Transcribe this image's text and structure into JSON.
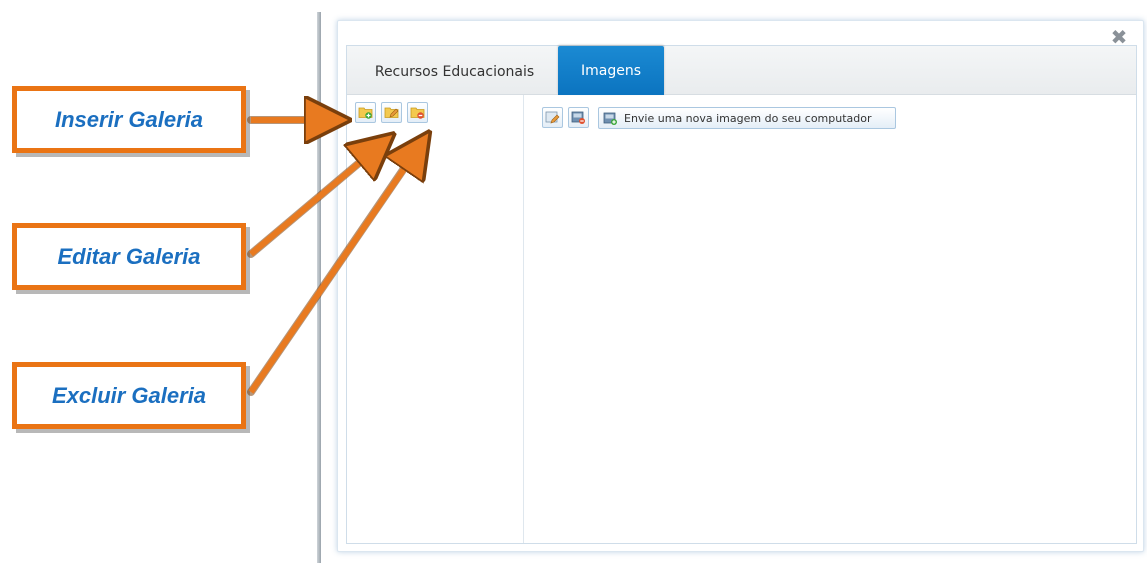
{
  "annotations": {
    "insert": "Inserir Galeria",
    "edit": "Editar Galeria",
    "delete": "Excluir Galeria"
  },
  "dialog": {
    "tabs": [
      {
        "label": "Recursos Educacionais",
        "active": false
      },
      {
        "label": "Imagens",
        "active": true
      }
    ],
    "close_icon": "close-icon",
    "close_glyph": "✖",
    "gallery_toolbar": [
      "folder-add-icon",
      "folder-edit-icon",
      "folder-delete-icon"
    ],
    "image_toolbar": {
      "icons": [
        "image-edit-icon",
        "image-delete-icon"
      ],
      "upload_label": "Envie uma nova imagem do seu computador",
      "upload_icon": "image-upload-icon"
    }
  },
  "colors": {
    "accent": "#0b74c0",
    "callout_border": "#ea7414",
    "callout_text": "#1b6fc0",
    "arrow": "#e87a20"
  }
}
